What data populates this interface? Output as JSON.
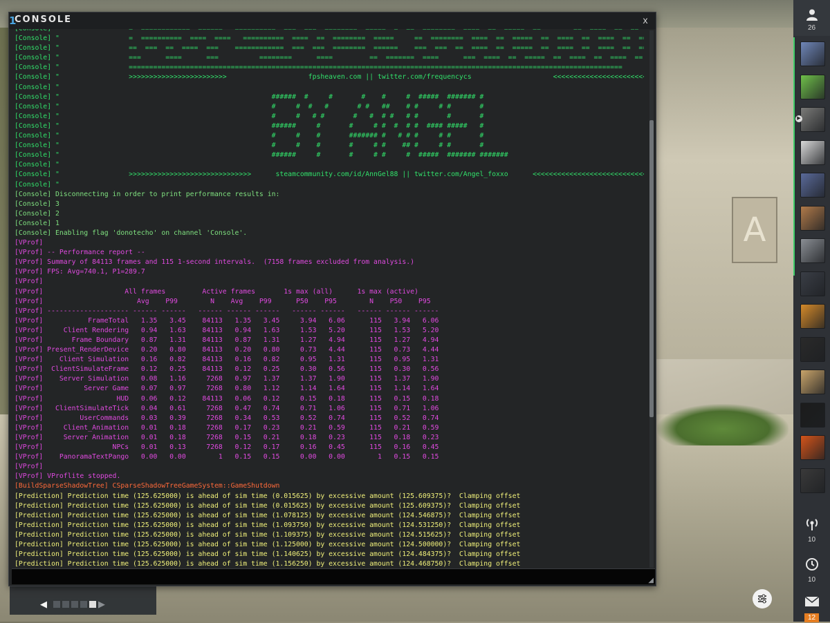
{
  "console": {
    "logo": "1",
    "title": "CONSOLE",
    "close": "x",
    "input_value": "",
    "lines": [
      {
        "cls": "c-banner",
        "text": "[Console] \"                 =  ============  ======   ==========  ===  ===  ========  =====  =  ==  ========  ====  ==  =====  ==        ==  ====  ==  ==  ===="
      },
      {
        "cls": "c-banner",
        "text": "[Console] \"                 =  ==========  ====  ====   ==========  ====  ==  ========  =====     ==  ========  ====  ==  =====  ==  ====  ==  ====  ==  ====  =="
      },
      {
        "cls": "c-banner",
        "text": "[Console] \"                 ==  ===  ==  ====  ===    ============  ===  ===  ========  ======    ===  ===  ==  ====  ==  =====  ==  ====  ==  ====  ==  ====  ="
      },
      {
        "cls": "c-banner",
        "text": "[Console] \"                 ===      ====      ===          ========      ====         ==  =======  ====      ===  ====  ==  =====  ==  ====  ==  ====  ==  ====  ="
      },
      {
        "cls": "c-banner",
        "text": "[Console] \"                 ========================================================================================================================="
      },
      {
        "cls": "c-banner",
        "text": "[Console] \"                 >>>>>>>>>>>>>>>>>>>>>>>>                    fpsheaven.com || twitter.com/frequencycs                    <<<<<<<<<<<<<<<<<<<<<<<<"
      },
      {
        "cls": "c-banner",
        "text": "[Console] \""
      },
      {
        "cls": "c-banner",
        "text": "[Console] \"                                                    ######  #     #       #    #     #  #####  ####### #"
      },
      {
        "cls": "c-banner",
        "text": "[Console] \"                                                    #     #  #   #       # #   ##    # #     # #       #"
      },
      {
        "cls": "c-banner",
        "text": "[Console] \"                                                    #     #   # #       #   #  # #   # #       #       #"
      },
      {
        "cls": "c-banner",
        "text": "[Console] \"                                                    ######     #       #     # #  #  # #  #### #####   #"
      },
      {
        "cls": "c-banner",
        "text": "[Console] \"                                                    #     #    #       ####### #   # # #     # #       #"
      },
      {
        "cls": "c-banner",
        "text": "[Console] \"                                                    #     #    #       #     # #    ## #     # #       #"
      },
      {
        "cls": "c-banner",
        "text": "[Console] \"                                                    ######     #       #     # #     #  #####  ####### #######"
      },
      {
        "cls": "c-banner",
        "text": "[Console] \""
      },
      {
        "cls": "c-banner",
        "text": "[Console] \"                 >>>>>>>>>>>>>>>>>>>>>>>>>>>>>>      steamcommunity.com/id/AnnGel88 || twitter.com/Angel_foxxo      <<<<<<<<<<<<<<<<<<<<<<<<<<<<<<"
      },
      {
        "cls": "c-banner",
        "text": "[Console] \""
      },
      {
        "cls": "c-console",
        "text": "[Console] Disconnecting in order to print performance results in:"
      },
      {
        "cls": "c-console",
        "text": "[Console] 3"
      },
      {
        "cls": "c-console",
        "text": "[Console] 2"
      },
      {
        "cls": "c-console",
        "text": "[Console] 1"
      },
      {
        "cls": "c-console",
        "text": "[Console] Enabling flag 'donotecho' on channel 'Console'."
      },
      {
        "cls": "c-vprof",
        "text": "[VProf]"
      },
      {
        "cls": "c-vprof",
        "text": "[VProf] -- Performance report --"
      },
      {
        "cls": "c-vprof",
        "text": "[VProf] Summary of 84113 frames and 115 1-second intervals.  (7158 frames excluded from analysis.)"
      },
      {
        "cls": "c-vprof",
        "text": "[VProf] FPS: Avg=740.1, P1=289.7"
      },
      {
        "cls": "c-vprof",
        "text": "[VProf]"
      },
      {
        "cls": "c-vprof",
        "text": "[VProf]                    All frames         Active frames       1s max (all)      1s max (active)"
      },
      {
        "cls": "c-vprof",
        "text": "[VProf]                       Avg    P99        N    Avg    P99      P50    P95        N    P50    P95"
      },
      {
        "cls": "c-vprof",
        "text": "[VProf] -------------------- ------ ------   ------ ------ ------   ------ ------   ------ ------ ------"
      },
      {
        "cls": "c-vprof",
        "text": "[VProf]           FrameTotal   1.35   3.45    84113   1.35   3.45     3.94   6.06      115   3.94   6.06"
      },
      {
        "cls": "c-vprof",
        "text": "[VProf]     Client Rendering   0.94   1.63    84113   0.94   1.63     1.53   5.20      115   1.53   5.20"
      },
      {
        "cls": "c-vprof",
        "text": "[VProf]       Frame Boundary   0.87   1.31    84113   0.87   1.31     1.27   4.94      115   1.27   4.94"
      },
      {
        "cls": "c-vprof",
        "text": "[VProf] Present_RenderDevice   0.20   0.80    84113   0.20   0.80     0.73   4.44      115   0.73   4.44"
      },
      {
        "cls": "c-vprof",
        "text": "[VProf]    Client Simulation   0.16   0.82    84113   0.16   0.82     0.95   1.31      115   0.95   1.31"
      },
      {
        "cls": "c-vprof",
        "text": "[VProf]  ClientSimulateFrame   0.12   0.25    84113   0.12   0.25     0.30   0.56      115   0.30   0.56"
      },
      {
        "cls": "c-vprof",
        "text": "[VProf]    Server Simulation   0.08   1.16     7268   0.97   1.37     1.37   1.90      115   1.37   1.90"
      },
      {
        "cls": "c-vprof",
        "text": "[VProf]          Server Game   0.07   0.97     7268   0.80   1.12     1.14   1.64      115   1.14   1.64"
      },
      {
        "cls": "c-vprof",
        "text": "[VProf]                  HUD   0.06   0.12    84113   0.06   0.12     0.15   0.18      115   0.15   0.18"
      },
      {
        "cls": "c-vprof",
        "text": "[VProf]   ClientSimulateTick   0.04   0.61     7268   0.47   0.74     0.71   1.06      115   0.71   1.06"
      },
      {
        "cls": "c-vprof",
        "text": "[VProf]         UserCommands   0.03   0.39     7268   0.34   0.53     0.52   0.74      115   0.52   0.74"
      },
      {
        "cls": "c-vprof",
        "text": "[VProf]     Client_Animation   0.01   0.18     7268   0.17   0.23     0.21   0.59      115   0.21   0.59"
      },
      {
        "cls": "c-vprof",
        "text": "[VProf]     Server Animation   0.01   0.18     7268   0.15   0.21     0.18   0.23      115   0.18   0.23"
      },
      {
        "cls": "c-vprof",
        "text": "[VProf]                 NPCs   0.01   0.13     7268   0.12   0.17     0.16   0.45      115   0.16   0.45"
      },
      {
        "cls": "c-vprof",
        "text": "[VProf]    PanoramaTextPango   0.00   0.00        1   0.15   0.15     0.00   0.00        1   0.15   0.15"
      },
      {
        "cls": "c-vprof",
        "text": "[VProf]"
      },
      {
        "cls": "c-vprof",
        "text": "[VProf] VProflite stopped."
      },
      {
        "cls": "c-shadow",
        "text": "[BuildSparseShadowTree] CSparseShadowTreeGameSystem::GameShutdown"
      },
      {
        "cls": "c-pred",
        "text": "[Prediction] Prediction time (125.625000) is ahead of sim time (0.015625) by excessive amount (125.609375)?  Clamping offset"
      },
      {
        "cls": "c-pred",
        "text": "[Prediction] Prediction time (125.625000) is ahead of sim time (0.015625) by excessive amount (125.609375)?  Clamping offset"
      },
      {
        "cls": "c-pred",
        "text": "[Prediction] Prediction time (125.625000) is ahead of sim time (1.078125) by excessive amount (124.546875)?  Clamping offset"
      },
      {
        "cls": "c-pred",
        "text": "[Prediction] Prediction time (125.625000) is ahead of sim time (1.093750) by excessive amount (124.531250)?  Clamping offset"
      },
      {
        "cls": "c-pred",
        "text": "[Prediction] Prediction time (125.625000) is ahead of sim time (1.109375) by excessive amount (124.515625)?  Clamping offset"
      },
      {
        "cls": "c-pred",
        "text": "[Prediction] Prediction time (125.625000) is ahead of sim time (1.125000) by excessive amount (124.500000)?  Clamping offset"
      },
      {
        "cls": "c-pred",
        "text": "[Prediction] Prediction time (125.625000) is ahead of sim time (1.140625) by excessive amount (124.484375)?  Clamping offset"
      },
      {
        "cls": "c-pred",
        "text": "[Prediction] Prediction time (125.625000) is ahead of sim time (1.156250) by excessive amount (124.468750)?  Clamping offset"
      }
    ]
  },
  "sidebar": {
    "friends_icon": "person-icon",
    "friends_count": "26",
    "avatars": [
      {
        "name": "friend-avatar-1",
        "color": "#6f86b8"
      },
      {
        "name": "friend-avatar-2",
        "color": "#6fbf4a"
      },
      {
        "name": "friend-avatar-3",
        "color": "#7a7a78",
        "status": "▶"
      },
      {
        "name": "friend-avatar-4",
        "color": "#d8d8d8"
      },
      {
        "name": "friend-avatar-5",
        "color": "#5a6a9a"
      },
      {
        "name": "friend-avatar-6",
        "color": "#b07a4a"
      },
      {
        "name": "friend-avatar-7",
        "color": "#8a8e94"
      },
      {
        "name": "friend-avatar-8",
        "color": "#3a3e46"
      },
      {
        "name": "friend-avatar-9",
        "color": "#d58a2a"
      },
      {
        "name": "friend-avatar-10",
        "color": "#2a2a2a"
      },
      {
        "name": "friend-avatar-11",
        "color": "#c9a46a"
      },
      {
        "name": "friend-avatar-12",
        "color": "#1c1c1c"
      },
      {
        "name": "friend-avatar-13",
        "color": "#d4541a"
      },
      {
        "name": "friend-avatar-14",
        "color": "#3a3a3a"
      }
    ],
    "broadcast_icon": "broadcast-icon",
    "broadcast_count": "10",
    "history_icon": "history-icon",
    "history_count": "10",
    "mail_icon": "mail-icon",
    "mail_count": "12",
    "settings_icon": "sliders-icon"
  },
  "under_panel": {
    "prev": "◀",
    "next": "▶",
    "pages": 5,
    "active_page": 5
  },
  "colors": {
    "console_text": "#7fe07f",
    "vprof_text": "#e04ae0",
    "prediction_text": "#f0f07a",
    "shadowtree_text": "#ff6a3a",
    "friend_online": "#3fcf6a",
    "mail_badge": "#e67e22"
  }
}
